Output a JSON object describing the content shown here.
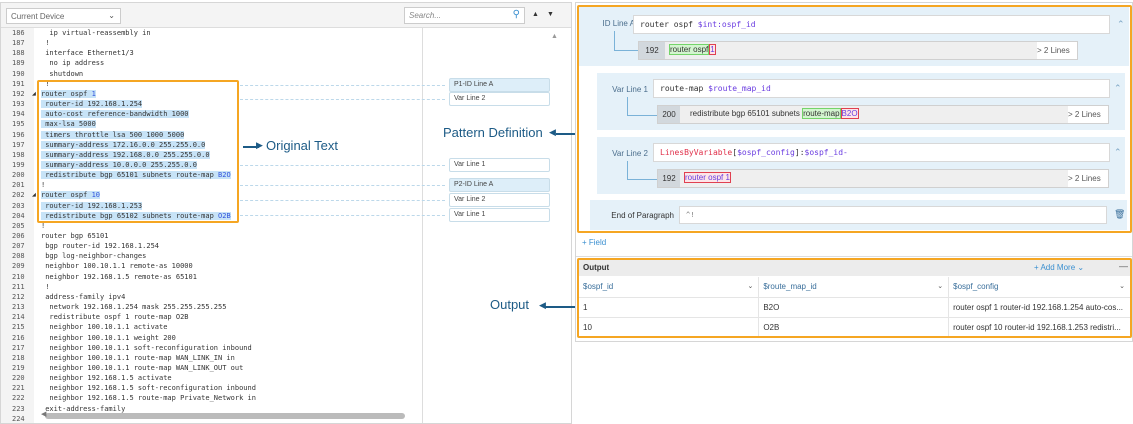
{
  "left": {
    "device_select": "Current Device",
    "search_placeholder": "Search...",
    "lines": [
      {
        "n": "186",
        "t": "  ip virtual-reassembly in"
      },
      {
        "n": "187",
        "t": " !"
      },
      {
        "n": "188",
        "t": " interface Ethernet1/3"
      },
      {
        "n": "189",
        "t": "  no ip address"
      },
      {
        "n": "190",
        "t": "  shutdown"
      },
      {
        "n": "191",
        "t": " !"
      },
      {
        "n": "192",
        "t": "router ospf ",
        "k": "1",
        "hl": true,
        "fold": true
      },
      {
        "n": "193",
        "t": " router-id 192.168.1.254",
        "hl": true
      },
      {
        "n": "194",
        "t": " auto-cost reference-bandwidth 1000",
        "hl": true
      },
      {
        "n": "195",
        "t": " max-lsa 5000",
        "hl": true
      },
      {
        "n": "196",
        "t": " timers throttle lsa 500 1000 5000",
        "hl": true
      },
      {
        "n": "197",
        "t": " summary-address 172.16.0.0 255.255.0.0",
        "hl": true
      },
      {
        "n": "198",
        "t": " summary-address 192.168.0.0 255.255.0.0",
        "hl": true
      },
      {
        "n": "199",
        "t": " summary-address 10.0.0.0 255.255.0.0",
        "hl": true
      },
      {
        "n": "200",
        "t": " redistribute bgp 65101 subnets route-map ",
        "k": "B2O",
        "hl": true
      },
      {
        "n": "201",
        "t": "!"
      },
      {
        "n": "202",
        "t": "router ospf ",
        "k": "10",
        "hl": true,
        "fold": true
      },
      {
        "n": "203",
        "t": " router-id 192.168.1.253",
        "hl": true
      },
      {
        "n": "204",
        "t": " redistribute bgp 65102 subnets route-map ",
        "k": "O2B",
        "hl": true
      },
      {
        "n": "205",
        "t": "!"
      },
      {
        "n": "206",
        "t": "router bgp 65101"
      },
      {
        "n": "207",
        "t": " bgp router-id 192.168.1.254"
      },
      {
        "n": "208",
        "t": " bgp log-neighbor-changes"
      },
      {
        "n": "209",
        "t": " neighbor 100.10.1.1 remote-as 10000"
      },
      {
        "n": "210",
        "t": " neighbor 192.168.1.5 remote-as 65101"
      },
      {
        "n": "211",
        "t": " !"
      },
      {
        "n": "212",
        "t": " address-family ipv4"
      },
      {
        "n": "213",
        "t": "  network 192.168.1.254 mask 255.255.255.255"
      },
      {
        "n": "214",
        "t": "  redistribute ospf 1 route-map O2B"
      },
      {
        "n": "215",
        "t": "  neighbor 100.10.1.1 activate"
      },
      {
        "n": "216",
        "t": "  neighbor 100.10.1.1 weight 200"
      },
      {
        "n": "217",
        "t": "  neighbor 100.10.1.1 soft-reconfiguration inbound"
      },
      {
        "n": "218",
        "t": "  neighbor 100.10.1.1 route-map WAN_LINK_IN in"
      },
      {
        "n": "219",
        "t": "  neighbor 100.10.1.1 route-map WAN_LINK_OUT out"
      },
      {
        "n": "220",
        "t": "  neighbor 192.168.1.5 activate"
      },
      {
        "n": "221",
        "t": "  neighbor 192.168.1.5 soft-reconfiguration inbound"
      },
      {
        "n": "222",
        "t": "  neighbor 192.168.1.5 route-map Private_Network in"
      },
      {
        "n": "223",
        "t": " exit-address-family"
      },
      {
        "n": "224",
        "t": ""
      }
    ],
    "markers": [
      "P1-ID Line A",
      "Var Line 2",
      "Var Line 1",
      "P2-ID Line A",
      "Var Line 2",
      "Var Line 1"
    ]
  },
  "callouts": {
    "original": "Original Text",
    "pattern": "Pattern Definition",
    "output": "Output"
  },
  "pattern": {
    "id_line": {
      "label": "ID Line A",
      "p1": "router ospf ",
      "v1": "$int:ospf_id",
      "num": "192",
      "m1": "router ospf",
      "m2": "1",
      "more": "> 2 Lines"
    },
    "var1": {
      "label": "Var Line 1",
      "p1": "route-map ",
      "v1": "$route_map_id",
      "num": "200",
      "pre": "redistribute bgp 65101 subnets ",
      "m1": "route-map",
      "m2": "B2O",
      "more": "> 2 Lines"
    },
    "var2": {
      "label": "Var Line 2",
      "fn": "LinesByVariable",
      "b1": "[",
      "v1": "$ospf_config",
      "b2": "]:",
      "v2": "$ospf_id-",
      "num": "192",
      "m1": "router ospf 1",
      "more": "> 2 Lines"
    },
    "eop": {
      "label": "End of Paragraph",
      "value": "^!"
    },
    "add_field": "+ Field"
  },
  "output": {
    "title": "Output",
    "add_more": "+ Add More",
    "columns": [
      "$ospf_id",
      "$route_map_id",
      "$ospf_config"
    ],
    "rows": [
      [
        "1",
        "B2O",
        "router ospf 1 router-id 192.168.1.254 auto-cos..."
      ],
      [
        "10",
        "O2B",
        "router ospf 10 router-id 192.168.1.253 redistri..."
      ]
    ]
  },
  "colors": {
    "highlight": "#f5a623",
    "accent": "#1d5b86"
  }
}
